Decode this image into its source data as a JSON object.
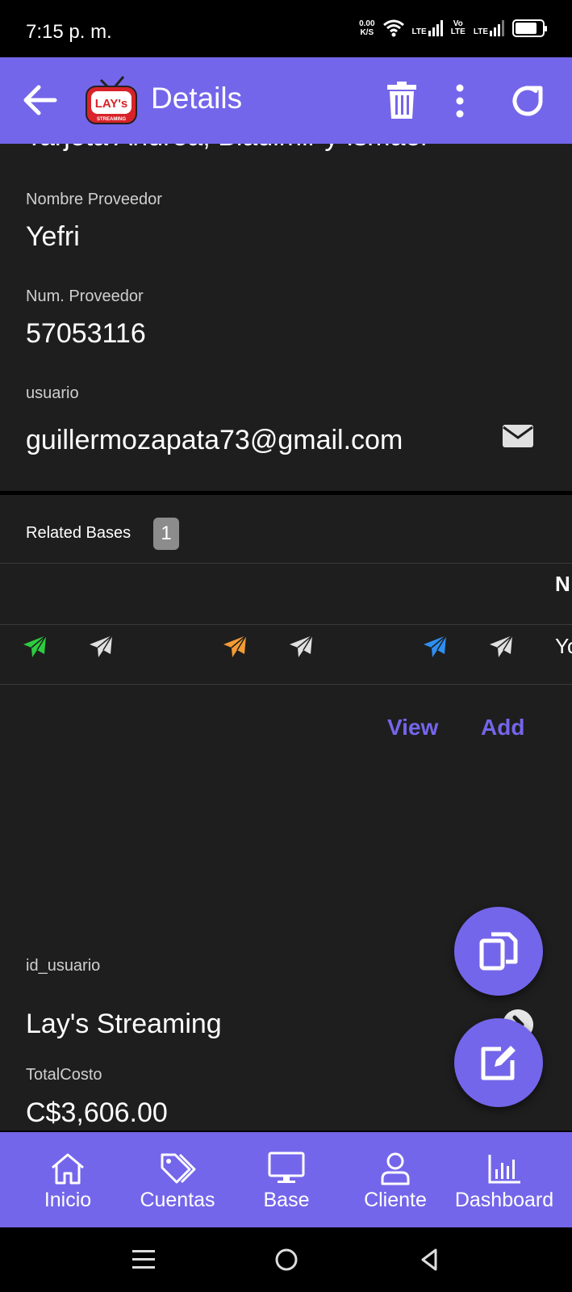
{
  "status_bar": {
    "time": "7:15 p. m.",
    "net_speed_value": "0.00",
    "net_speed_unit": "K/S",
    "lte1": "LTE",
    "volte_top": "Vo",
    "volte_bottom": "LTE",
    "lte2": "LTE"
  },
  "appbar": {
    "title": "Details",
    "logo_text": "LAY's",
    "logo_subtext": "STREAMING",
    "icons": [
      "arrow-left-icon",
      "trash-icon",
      "more-vert-icon",
      "refresh-icon"
    ]
  },
  "details": {
    "cut_title": "Tarjeta Andrea, Bladimir y Ismael",
    "provider_name_label": "Nombre Proveedor",
    "provider_name_value": "Yefri",
    "provider_num_label": "Num. Proveedor",
    "provider_num_value": "57053116",
    "user_label": "usuario",
    "user_value": "guillermozapata73@gmail.com"
  },
  "related": {
    "label": "Related Bases",
    "count": "1",
    "column_header_partial": "N",
    "row_partial_text": "Yo",
    "plane_colors": [
      "#2ecc40",
      "#e0e0e0",
      "#f39c34",
      "#e0e0e0",
      "#2f8ff0",
      "#e0e0e0"
    ],
    "view_label": "View",
    "add_label": "Add"
  },
  "extra": {
    "id_usuario_label": "id_usuario",
    "id_usuario_value": "Lay's Streaming",
    "total_label": "TotalCosto",
    "total_value": "C$3,606.00"
  },
  "bottom_nav": {
    "items": [
      {
        "label": "Inicio",
        "icon": "home-icon"
      },
      {
        "label": "Cuentas",
        "icon": "tags-icon"
      },
      {
        "label": "Base",
        "icon": "desktop-icon"
      },
      {
        "label": "Cliente",
        "icon": "user-icon"
      },
      {
        "label": "Dashboard",
        "icon": "chart-icon"
      }
    ]
  },
  "colors": {
    "accent": "#7466ea",
    "surface": "#1e1e1e",
    "background": "#000000"
  }
}
